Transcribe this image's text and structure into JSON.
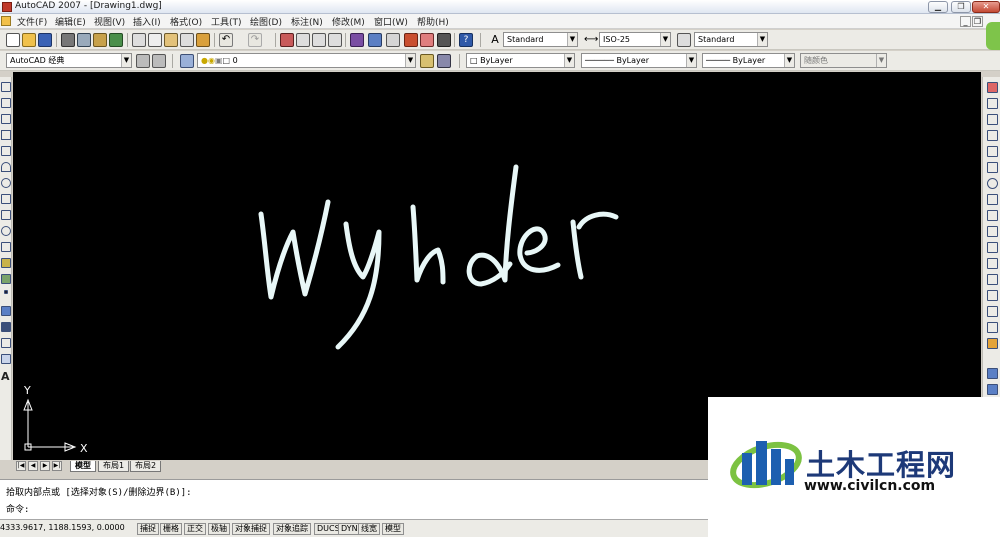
{
  "window": {
    "title": "AutoCAD 2007 - [Drawing1.dwg]"
  },
  "menu": [
    "文件(F)",
    "编辑(E)",
    "视图(V)",
    "插入(I)",
    "格式(O)",
    "工具(T)",
    "绘图(D)",
    "标注(N)",
    "修改(M)",
    "窗口(W)",
    "帮助(H)"
  ],
  "styles": {
    "text_style": "Standard",
    "dim_style": "ISO-25",
    "table_style": "Standard"
  },
  "workspace": {
    "value": "AutoCAD 经典"
  },
  "layer": {
    "value": "0"
  },
  "properties": {
    "color": "ByLayer",
    "linetype": "ByLayer",
    "lineweight": "ByLayer",
    "plotstyle": "随颜色"
  },
  "canvas": {
    "drawn_text": "Wyhder",
    "axis_x": "X",
    "axis_y": "Y",
    "background": "#000000",
    "stroke": "#e8f7f7"
  },
  "tabs": [
    {
      "label": "模型",
      "active": true
    },
    {
      "label": "布局1",
      "active": false
    },
    {
      "label": "布局2",
      "active": false
    }
  ],
  "command": {
    "line1": "拾取内部点或 [选择对象(S)/删除边界(B)]:",
    "line2": "命令:"
  },
  "status": {
    "coords": "4333.9617, 1188.1593, 0.0000",
    "buttons": [
      "捕捉",
      "栅格",
      "正交",
      "极轴",
      "对象捕捉",
      "对象追踪",
      "DUCS",
      "DYN",
      "线宽",
      "模型"
    ]
  },
  "watermark": {
    "title": "土木工程网",
    "url": "www.civilcn.com"
  },
  "colors": {
    "accent": "#1d3978",
    "toolbar": "#ecebe6",
    "titlebar": "#dfe6f2"
  }
}
